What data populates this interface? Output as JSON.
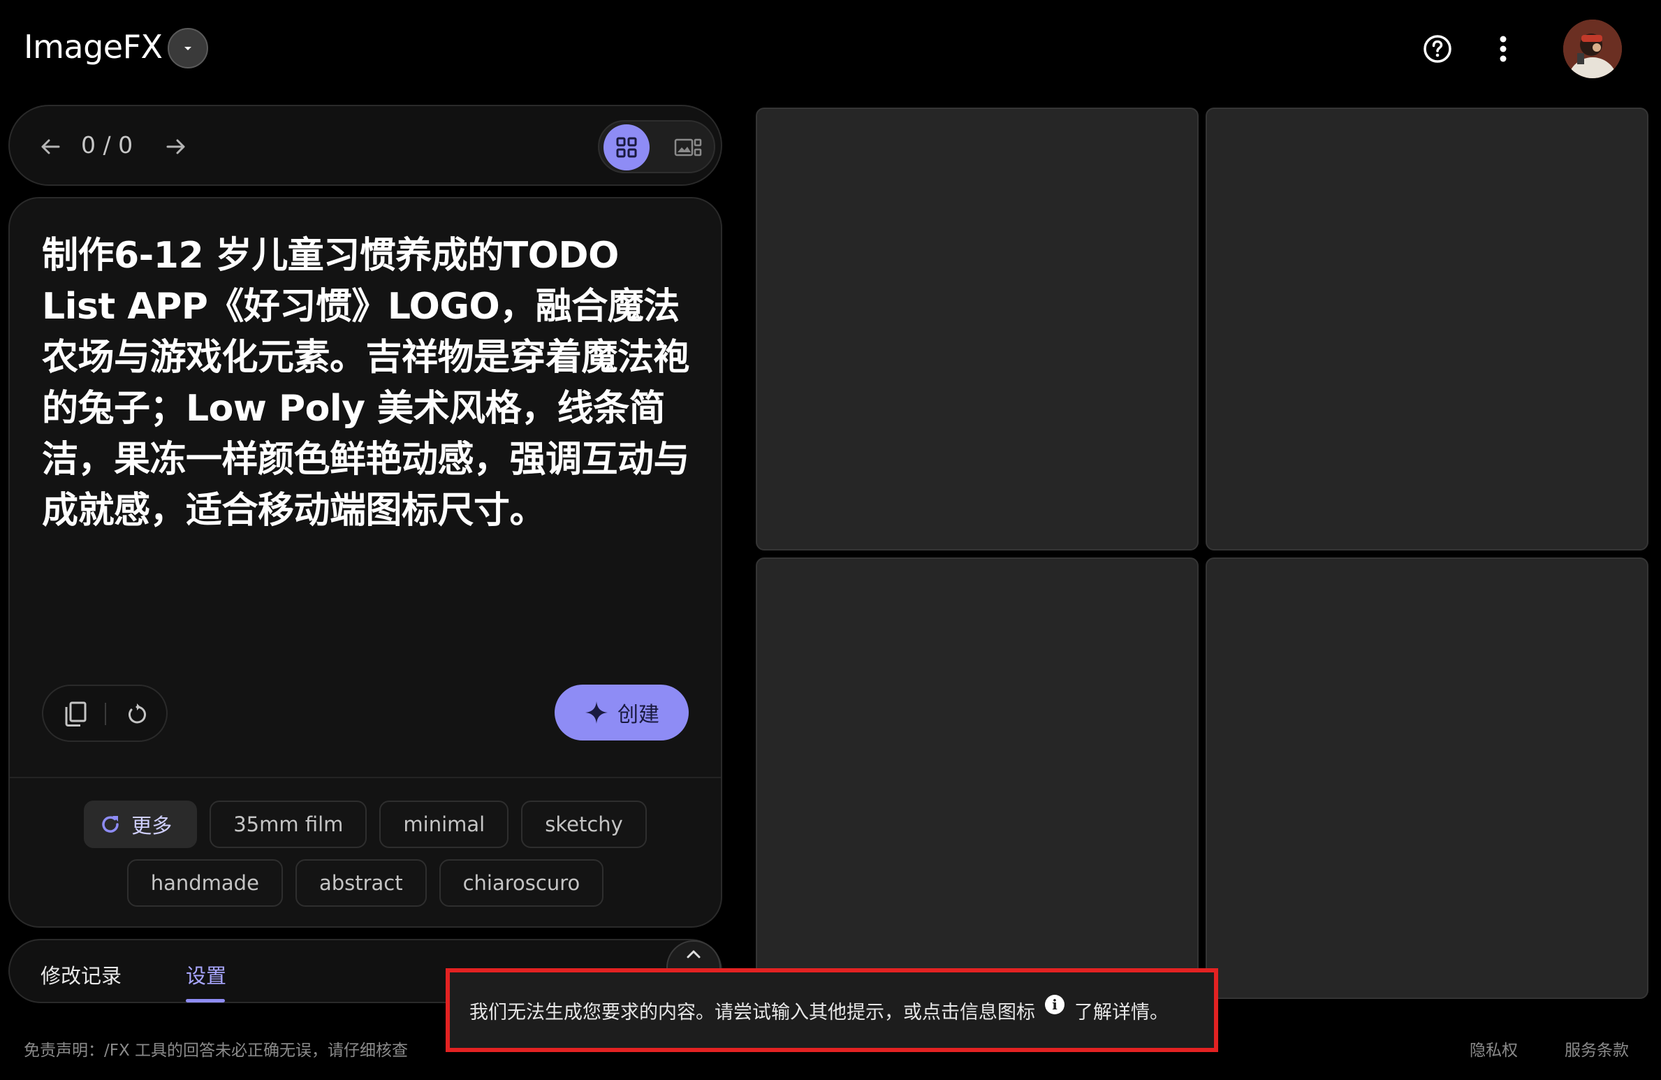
{
  "header": {
    "app_title": "ImageFX",
    "icons": {
      "dropdown": "chevron-down-icon",
      "help": "help-circle-icon",
      "more": "more-vertical-icon"
    }
  },
  "nav": {
    "counter": "0 / 0",
    "view_selected": "grid"
  },
  "prompt": {
    "text": "制作6-12 岁儿童习惯养成的TODO List APP《好习惯》LOGO，融合魔法农场与游戏化元素。吉祥物是穿着魔法袍的兔子；Low Poly 美术风格，线条简洁，果冻一样颜色鲜艳动感，强调互动与成就感，适合移动端图标尺寸。"
  },
  "actions": {
    "create_label": "创建"
  },
  "chips": {
    "more_label": "更多",
    "row1": [
      "35mm film",
      "minimal",
      "sketchy"
    ],
    "row2": [
      "handmade",
      "abstract",
      "chiaroscuro"
    ]
  },
  "tabs": {
    "history_label": "修改记录",
    "settings_label": "设置",
    "active": "settings"
  },
  "footer": {
    "disclaimer": "免责声明：/FX 工具的回答未必正确无误，请仔细核查",
    "privacy": "隐私权",
    "terms": "服务条款"
  },
  "toast": {
    "message_before": "我们无法生成您要求的内容。请尝试输入其他提示，或点击信息图标",
    "message_after": "了解详情。",
    "highlight_color": "#e32222"
  },
  "colors": {
    "accent": "#8e8cf5",
    "background": "#000000",
    "panel": "#131313",
    "image_slot": "#262626"
  }
}
